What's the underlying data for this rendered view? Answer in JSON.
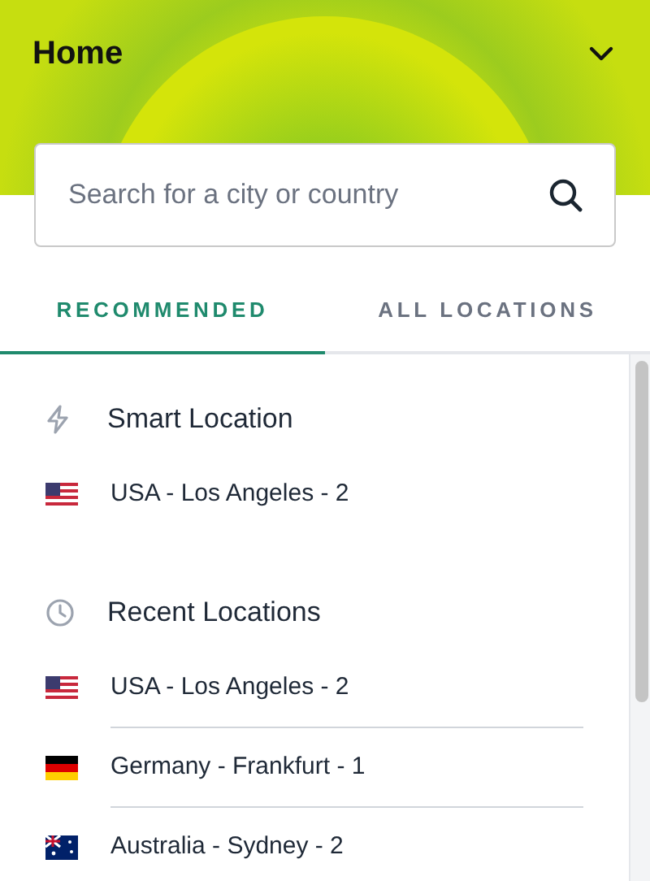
{
  "header": {
    "title": "Home"
  },
  "search": {
    "placeholder": "Search for a city or country"
  },
  "tabs": [
    {
      "label": "RECOMMENDED",
      "selected": true
    },
    {
      "label": "ALL LOCATIONS",
      "selected": false
    }
  ],
  "sections": [
    {
      "title": "Smart Location",
      "kind": "smart",
      "items": [
        {
          "label": "USA - Los Angeles - 2",
          "kind": "us"
        }
      ]
    },
    {
      "title": "Recent Locations",
      "kind": "recent",
      "items": [
        {
          "label": "USA - Los Angeles - 2",
          "kind": "us"
        },
        {
          "label": "Germany - Frankfurt - 1",
          "kind": "de"
        },
        {
          "label": "Australia - Sydney - 2",
          "kind": "au"
        }
      ]
    }
  ]
}
